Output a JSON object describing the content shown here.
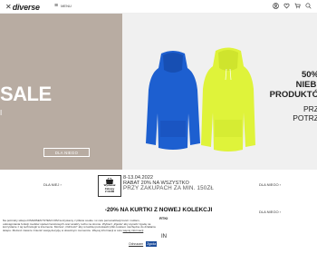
{
  "header": {
    "logo": "diverse",
    "menu_label": "MENU",
    "icons": [
      "user-icon",
      "heart-icon",
      "cart-icon",
      "search-icon"
    ]
  },
  "hero_left": {
    "headline": "SALE",
    "subline": "I",
    "button_label": "DLA NIEGO"
  },
  "hero_right": {
    "line1": "50%",
    "line2": "NIEBI",
    "line3": "PRODUKTÓ",
    "line4": "PRZ",
    "line5": "POTRZ"
  },
  "strip": {
    "link_left": "DLA NIEJ ›",
    "link_right": "DLA NIEGO ›",
    "link_right2": "DLA NIEGO ›",
    "badge_lines": [
      "Wydawał",
      "Zakupy",
      "Z NAMI"
    ],
    "rabat_dates": "8-13.04.2022",
    "rabat_line": "RABAT 20% NA WSZYSTKO",
    "rabat_cond": "PRZY ZAKUPACH ZA MIN. 150ZŁ",
    "banner": "-20% NA KURTKI Z NOWEJ KOLEKCJI",
    "cut_label1": "RTKI",
    "cut_label2": "IN"
  },
  "cookie": {
    "text": "Na potrzeby sklepu DIVERSESYSTEM.COM korzystamy z plików cookie i w celu personalizacji treści i reklam, udostępniania funkcji mediów społecznościowych oraz analizy ruchu na stronie. Wybierz „Zgoda” aby wyrazić zgodę na korzystanie z tej technologii w internecie. Możesz „Odrzucić” aby w każdej pozostawić pliki cookiem niezbędne do działania sklepu. Możesz zawsze zmienić swoją decyzję w dowolnym momencie. Więcej informacji w celu",
    "link": "więcej informacji",
    "decline": "Odrzucam",
    "accept": "Zgoda"
  },
  "colors": {
    "hero_left_bg": "#b8aca2",
    "hero_right_bg": "#f0f0f0",
    "hoodie_blue": "#1d5fd0",
    "hoodie_lime": "#dff33a",
    "accept_button": "#1e4e9c"
  }
}
